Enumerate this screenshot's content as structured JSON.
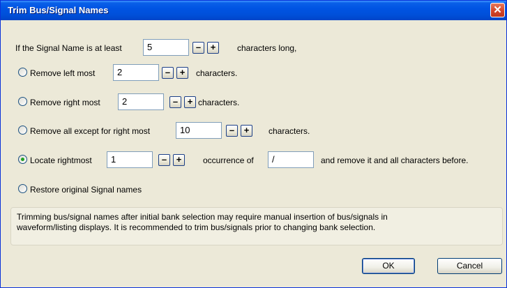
{
  "window": {
    "title": "Trim Bus/Signal Names",
    "close_glyph": "✕",
    "colors": {
      "titlebar": "#0054e3",
      "face": "#ece9d8",
      "close": "#d4452a",
      "selected_radio": "#21a121"
    }
  },
  "threshold": {
    "prefix": "If the Signal Name is at least",
    "value": "5",
    "suffix": "characters long,"
  },
  "stepper": {
    "minus": "–",
    "plus": "+"
  },
  "options": {
    "remove_left": {
      "label": "Remove left most",
      "value": "2",
      "suffix": "characters.",
      "selected": false
    },
    "remove_right": {
      "label": "Remove right most",
      "value": "2",
      "suffix": "characters.",
      "selected": false
    },
    "remove_all_except": {
      "label": "Remove all except for right most",
      "value": "10",
      "suffix": "characters.",
      "selected": false
    },
    "locate": {
      "label": "Locate rightmost",
      "value": "1",
      "middle": "occurrence of",
      "delimiter": "/",
      "suffix": "and remove it and all characters before.",
      "selected": true
    },
    "restore": {
      "label": "Restore original Signal names",
      "selected": false
    }
  },
  "note": {
    "line1": "Trimming bus/signal names after initial bank selection may require manual insertion of bus/signals in",
    "line2": "waveform/listing displays.  It is recommended to trim bus/signals prior to changing bank selection."
  },
  "buttons": {
    "ok": "OK",
    "cancel": "Cancel"
  }
}
